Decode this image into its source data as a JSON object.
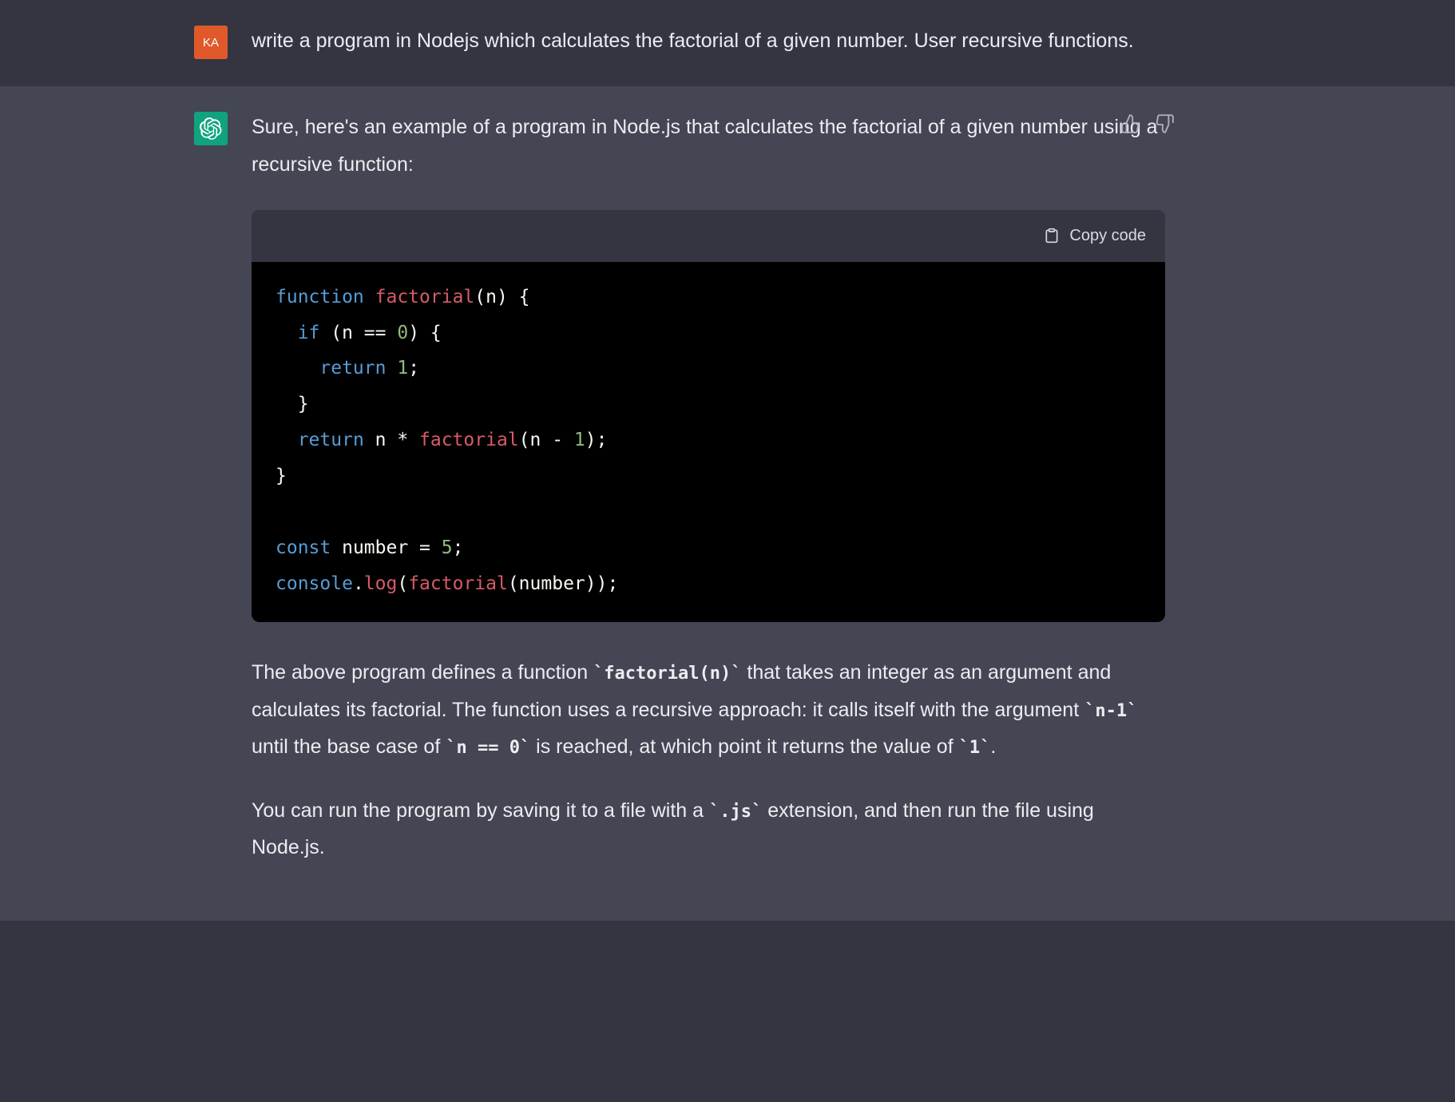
{
  "user": {
    "initials": "KA",
    "prompt": "write a program in Nodejs which calculates the factorial of a given number. User recursive functions."
  },
  "assistant": {
    "intro": "Sure, here's an example of a program in Node.js that calculates the factorial of a given number using a recursive function:",
    "copy_label": "Copy code",
    "code": {
      "t1": "function",
      "t2": " ",
      "t3": "factorial",
      "t4": "(",
      "t5": "n",
      "t6": ") {",
      "t7": "  ",
      "t8": "if",
      "t9": " (n == ",
      "t10": "0",
      "t11": ") {",
      "t12": "    ",
      "t13": "return",
      "t14": " ",
      "t15": "1",
      "t16": ";",
      "t17": "  }",
      "t18": "  ",
      "t19": "return",
      "t20": " n * ",
      "t21": "factorial",
      "t22": "(n - ",
      "t23": "1",
      "t24": ");",
      "t25": "}",
      "t26": "",
      "t27": "const",
      "t28": " number = ",
      "t29": "5",
      "t30": ";",
      "t31": "console",
      "t32": ".",
      "t33": "log",
      "t34": "(",
      "t35": "factorial",
      "t36": "(number));"
    },
    "exp_p1a": "The above program defines a function ",
    "exp_c1": "`factorial(n)`",
    "exp_p1b": " that takes an integer as an argument and calculates its factorial. The function uses a recursive approach: it calls itself with the argument ",
    "exp_c2": "`n-1`",
    "exp_p1c": " until the base case of ",
    "exp_c3": "`n == 0`",
    "exp_p1d": " is reached, at which point it returns the value of ",
    "exp_c4": "`1`",
    "exp_p1e": ".",
    "exp_p2a": "You can run the program by saving it to a file with a ",
    "exp_c5": "`.js`",
    "exp_p2b": " extension, and then run the file using Node.js."
  }
}
